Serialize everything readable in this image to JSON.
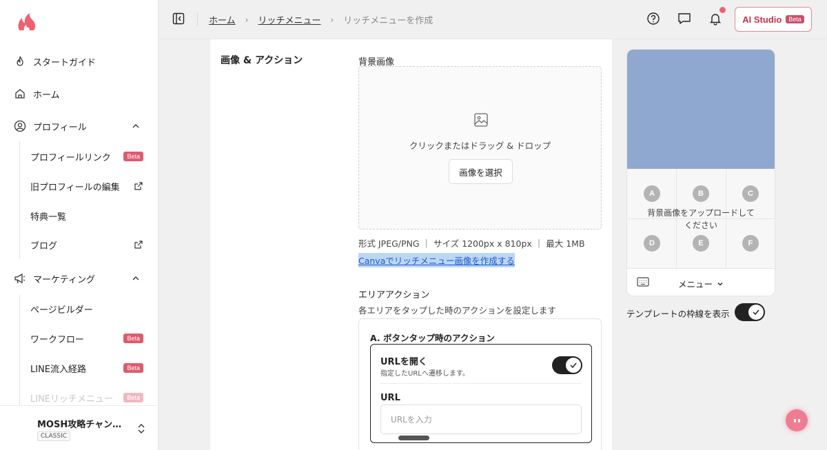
{
  "sidebar": {
    "items": [
      {
        "label": "スタートガイド",
        "icon": "flame-icon"
      },
      {
        "label": "ホーム",
        "icon": "home-icon"
      },
      {
        "label": "プロフィール",
        "icon": "user-circle-icon"
      },
      {
        "label": "マーケティング",
        "icon": "megaphone-icon"
      }
    ],
    "profile_sub": [
      {
        "label": "プロフィールリンク",
        "badge": "Beta"
      },
      {
        "label": "旧プロフィールの編集",
        "icon": "external-link-icon"
      },
      {
        "label": "特典一覧"
      },
      {
        "label": "ブログ",
        "icon": "external-link-icon"
      }
    ],
    "marketing_sub": [
      {
        "label": "ページビルダー"
      },
      {
        "label": "ワークフロー",
        "badge": "Beta"
      },
      {
        "label": "LINE流入経路",
        "badge": "Beta"
      },
      {
        "label": "LINEリッチメニュー",
        "badge": "Beta"
      }
    ],
    "account": {
      "name": "MOSH攻略チャン…",
      "plan": "CLASSIC"
    }
  },
  "header": {
    "breadcrumb": [
      "ホーム",
      "リッチメニュー",
      "リッチメニューを作成"
    ],
    "ai_studio": "AI Studio",
    "ai_badge": "Beta"
  },
  "main": {
    "section_title": "画像 & アクション",
    "bg_label": "背景画像",
    "drop_hint": "クリックまたはドラッグ & ドロップ",
    "select_button": "画像を選択",
    "format": "形式 JPEG/PNG ｜ サイズ 1200px x 810px ｜ 最大 1MB",
    "canva_link": "Canvaでリッチメニュー画像を作成する",
    "area_title": "エリアアクション",
    "area_desc": "各エリアをタップした時のアクションを設定します",
    "action_title": "A. ボタンタップ時のアクション",
    "open_url": "URLを開く",
    "open_url_desc": "指定したURLへ遷移します。",
    "url_label": "URL",
    "url_placeholder": "URLを入力"
  },
  "preview": {
    "cells": [
      "A",
      "B",
      "C",
      "D",
      "E",
      "F"
    ],
    "upload_msg": "背景画像をアップロードして",
    "upload_msg2": "ください",
    "menu_label": "メニュー",
    "template_label": "テンプレートの枠線を表示"
  },
  "colors": {
    "accent": "#e05a6e",
    "preview_bg": "#8fa8cf"
  }
}
